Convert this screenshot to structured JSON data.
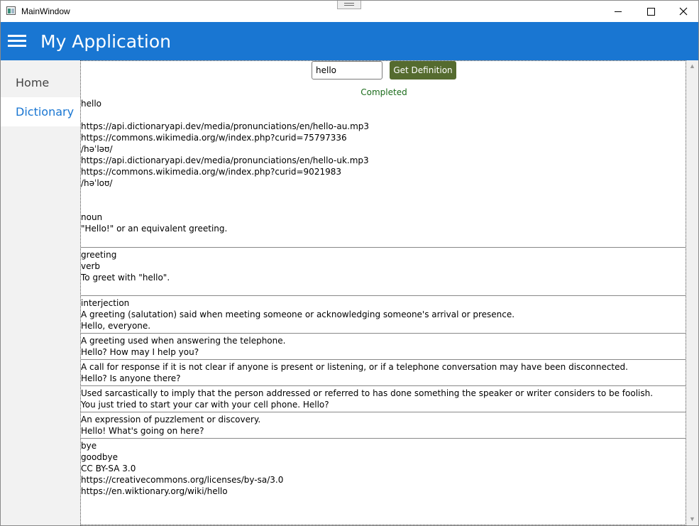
{
  "window": {
    "title": "MainWindow"
  },
  "appbar": {
    "title": "My Application"
  },
  "nav": {
    "items": [
      {
        "label": "Home"
      },
      {
        "label": "Dictionary"
      }
    ]
  },
  "search": {
    "value": "hello",
    "button_label": "Get Definition"
  },
  "status": "Completed",
  "entry": {
    "word": "hello",
    "phonetics": [
      "https://api.dictionaryapi.dev/media/pronunciations/en/hello-au.mp3",
      "https://commons.wikimedia.org/w/index.php?curid=75797336",
      "/həˈləʊ/",
      "https://api.dictionaryapi.dev/media/pronunciations/en/hello-uk.mp3",
      "https://commons.wikimedia.org/w/index.php?curid=9021983",
      "/həˈloʊ/"
    ],
    "noun": {
      "part": "noun",
      "definition": "\"Hello!\" or an equivalent greeting.",
      "synonym": "greeting"
    },
    "verb": {
      "part": "verb",
      "definition": "To greet with \"hello\"."
    },
    "interjection": {
      "part": "interjection",
      "definitions": [
        {
          "text": "A greeting (salutation) said when meeting someone or acknowledging someone's arrival or presence.",
          "example": "Hello, everyone."
        },
        {
          "text": "A greeting used when answering the telephone.",
          "example": "Hello? How may I help you?"
        },
        {
          "text": "A call for response if it is not clear if anyone is present or listening, or if a telephone conversation may have been disconnected.",
          "example": "Hello? Is anyone there?"
        },
        {
          "text": "Used sarcastically to imply that the person addressed or referred to has done something the speaker or writer considers to be foolish.",
          "example": "You just tried to start your car with your cell phone. Hello?"
        },
        {
          "text": "An expression of puzzlement or discovery.",
          "example": "Hello! What's going on here?"
        }
      ],
      "antonyms": [
        "bye",
        "goodbye"
      ]
    },
    "license": {
      "name": "CC BY-SA 3.0",
      "url": "https://creativecommons.org/licenses/by-sa/3.0"
    },
    "source": "https://en.wiktionary.org/wiki/hello"
  }
}
